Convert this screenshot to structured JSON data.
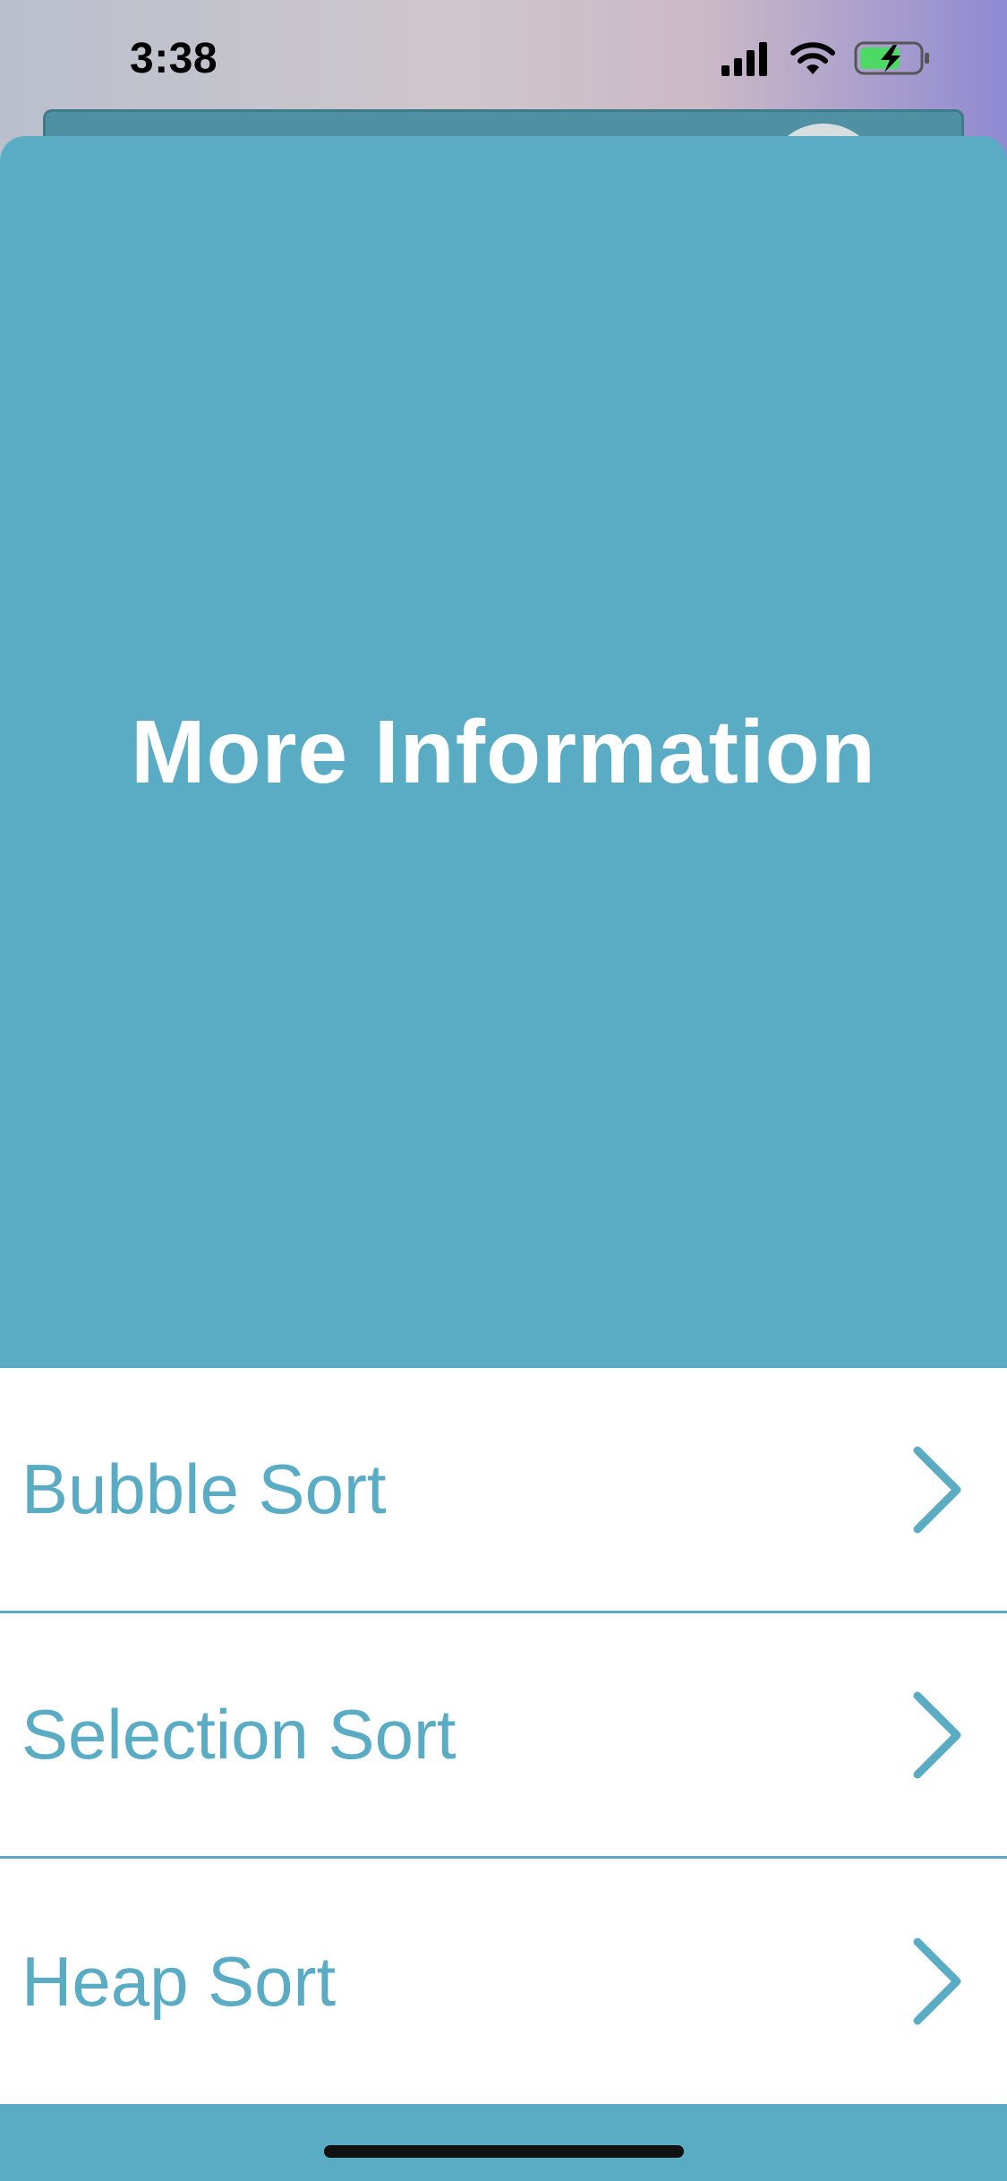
{
  "status_bar": {
    "time": "3:38",
    "icons": [
      "cellular-signal-icon",
      "wifi-icon",
      "battery-charging-icon"
    ]
  },
  "sheet": {
    "title": "More Information",
    "items": [
      {
        "label": "Bubble Sort",
        "icon": "chevron-right-icon"
      },
      {
        "label": "Selection Sort",
        "icon": "chevron-right-icon"
      },
      {
        "label": "Heap Sort",
        "icon": "chevron-right-icon"
      }
    ]
  },
  "colors": {
    "accent": "#5aabc4",
    "list_background": "#ffffff",
    "title_text": "#ffffff",
    "battery_fill": "#4cd964"
  }
}
